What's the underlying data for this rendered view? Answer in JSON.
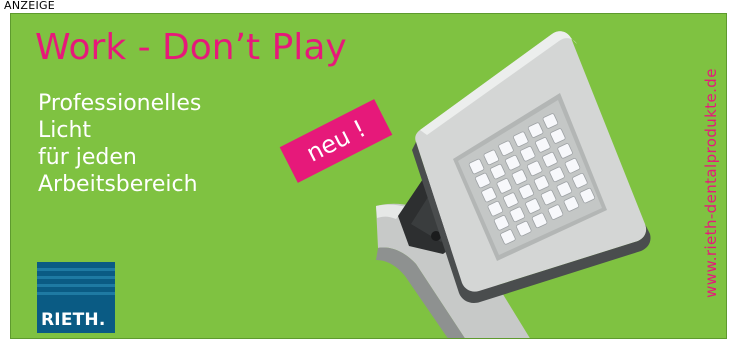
{
  "top_label": "ANZEIGE",
  "ad": {
    "headline": "Work - Don’t Play",
    "tagline_lines": [
      "Professionelles",
      "Licht",
      "für jeden",
      "Arbeitsbereich"
    ],
    "badge": "neu !",
    "brand": "RIETH.",
    "url": "www.rieth-dentalprodukte.de"
  },
  "colors": {
    "background": "#7fc241",
    "accent_pink": "#e6197a",
    "logo_blue": "#0a5b84",
    "text_white": "#ffffff"
  }
}
